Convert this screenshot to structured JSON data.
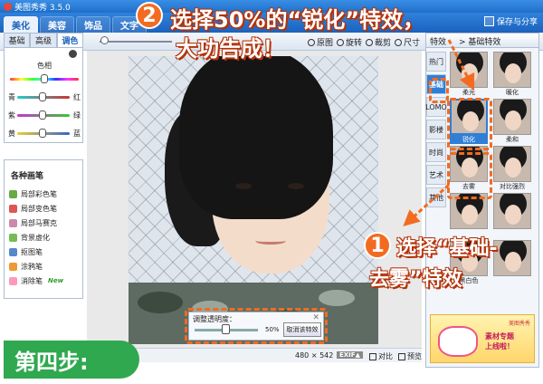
{
  "app": {
    "title": "美图秀秀 3.5.0"
  },
  "main_tabs": [
    {
      "label": "美化",
      "active": true
    },
    {
      "label": "美容",
      "active": false
    },
    {
      "label": "饰品",
      "active": false
    },
    {
      "label": "文字",
      "active": false
    }
  ],
  "save_share_label": "保存与分享",
  "toolbar": {
    "original_label": "原图",
    "rotate_label": "旋转",
    "crop_label": "裁剪",
    "size_label": "尺寸"
  },
  "left_panel": {
    "subtabs": [
      {
        "label": "基础",
        "active": false
      },
      {
        "label": "高级",
        "active": false
      },
      {
        "label": "调色",
        "active": true
      }
    ],
    "hue_label": "色相",
    "color_sliders": [
      {
        "left": "青",
        "right": "红"
      },
      {
        "left": "紫",
        "right": "绿"
      },
      {
        "left": "黄",
        "right": "蓝"
      }
    ],
    "brush_title": "各种画笔",
    "brushes": [
      {
        "label": "局部彩色笔",
        "color": "#6a4"
      },
      {
        "label": "局部变色笔",
        "color": "#d55"
      },
      {
        "label": "局部马赛克",
        "color": "#c8a"
      },
      {
        "label": "背景虚化",
        "color": "#7b5"
      },
      {
        "label": "抠图笔",
        "color": "#58c"
      },
      {
        "label": "涂鸦笔",
        "color": "#e93"
      },
      {
        "label": "消除笔",
        "color": "#f9b",
        "badge": "New"
      }
    ]
  },
  "opacity_popup": {
    "title": "调整透明度：",
    "value": "50%",
    "cancel_label": "取消该特效",
    "close_label": "✕"
  },
  "status_bar": {
    "width": "480",
    "height": "542",
    "exif": "EXIF▲",
    "compare_label": "对比",
    "preview_label": "预览"
  },
  "effects_panel": {
    "header_left": "特效",
    "header_right": "> 基础特效",
    "categories": [
      {
        "label": "热门",
        "active": false
      },
      {
        "label": "基础",
        "active": true
      },
      {
        "label": "LOMO",
        "active": false
      },
      {
        "label": "影楼",
        "active": false
      },
      {
        "label": "时尚",
        "active": false
      },
      {
        "label": "艺术",
        "active": false
      },
      {
        "label": "其他",
        "active": false
      }
    ],
    "thumbs": [
      {
        "label": "柔光",
        "selected": false
      },
      {
        "label": "暖化",
        "selected": false
      },
      {
        "label": "锐化",
        "selected": true
      },
      {
        "label": "柔和",
        "selected": false
      },
      {
        "label": "去雾",
        "selected": false
      },
      {
        "label": "对比强烈",
        "selected": false
      },
      {
        "label": "",
        "selected": false
      },
      {
        "label": "",
        "selected": false
      },
      {
        "label": "黑白色",
        "selected": false
      },
      {
        "label": "",
        "selected": false
      }
    ],
    "ad": {
      "brand": "美图秀秀",
      "line1": "素材专题",
      "line2": "上线啦！"
    }
  },
  "annotations": {
    "step2_number": "2",
    "step2_text_line1": "选择50%的“锐化”特效，",
    "step2_text_line2": "大功告成！",
    "step1_number": "1",
    "step1_text_line1": "选择“基础-",
    "step1_text_line2": "去雾”特效",
    "step4_label": "第四步:",
    "accent_color": "#f26b21"
  }
}
